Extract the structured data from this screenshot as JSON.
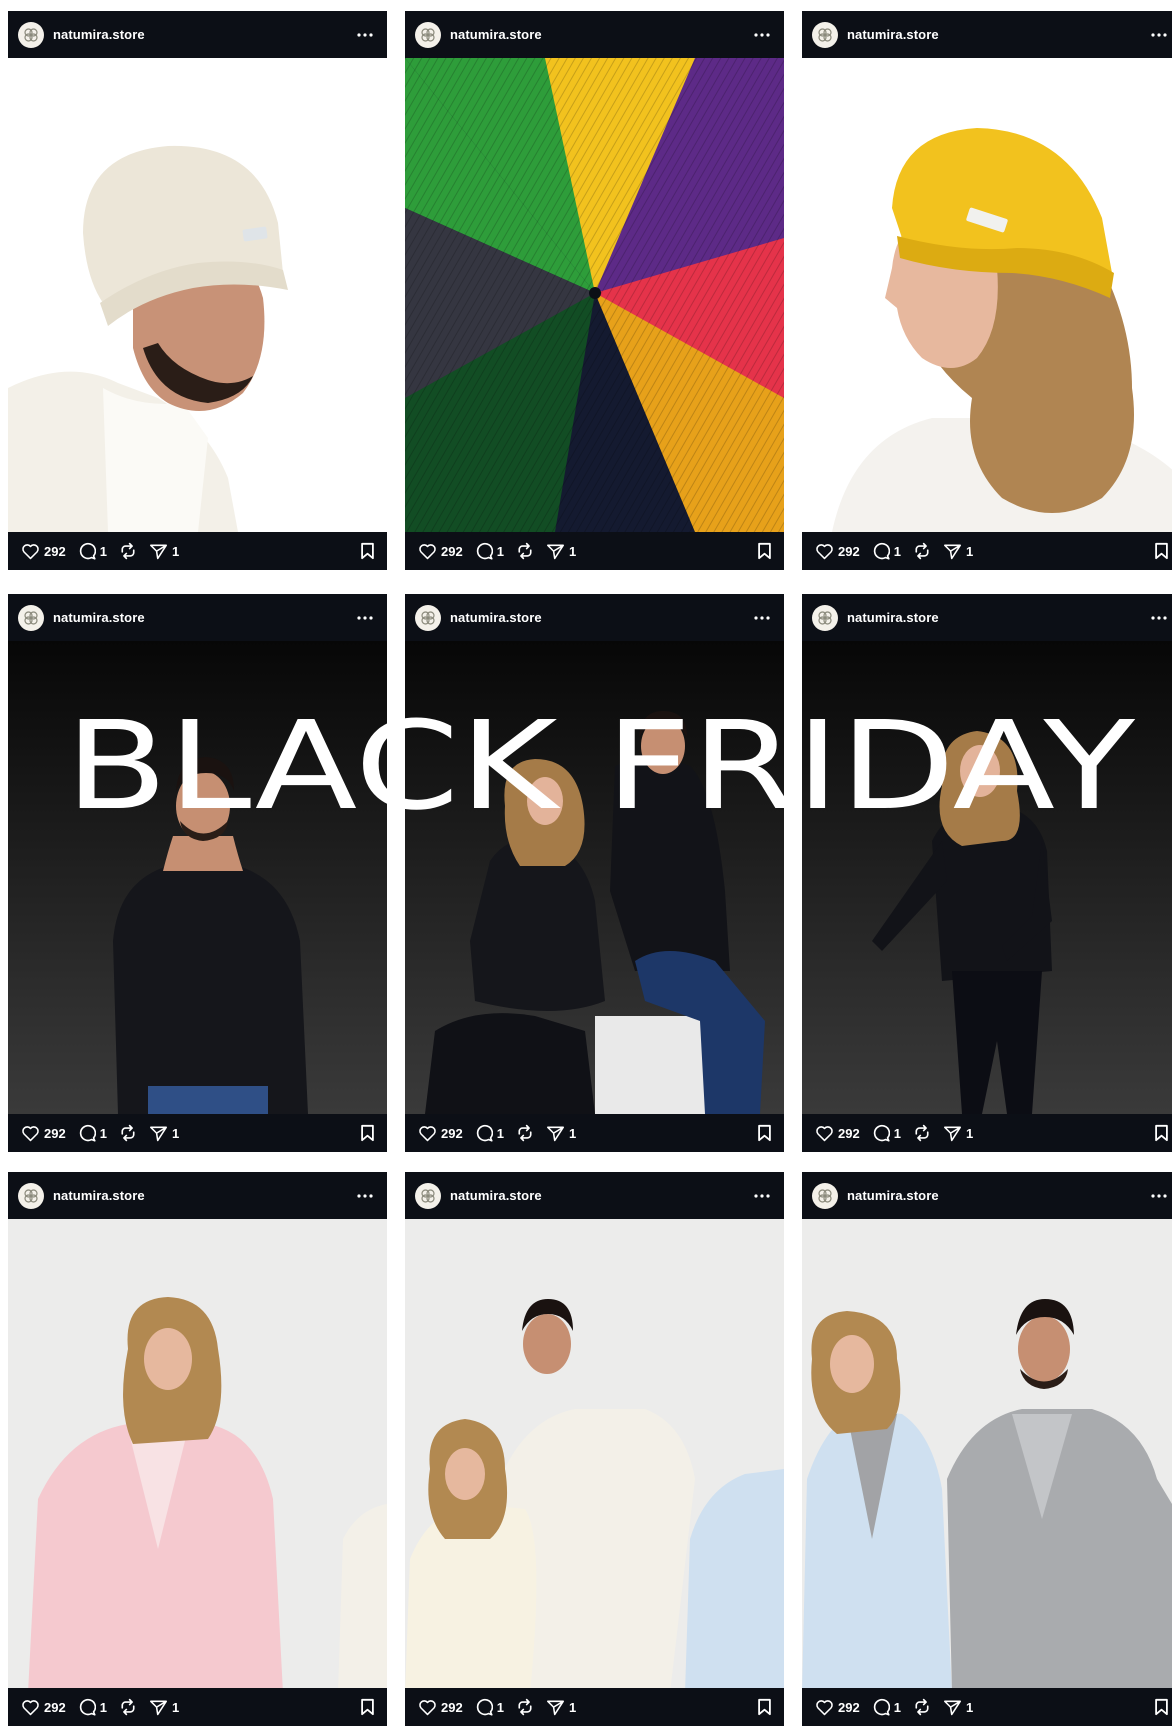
{
  "profile": {
    "username": "natumira.store",
    "avatar_icon": "natumira-logo-icon"
  },
  "banner": {
    "text": "BLACK FRIDAY"
  },
  "posts": [
    {
      "username": "natumira.store",
      "likes": "292",
      "comments": "1",
      "shares": "1"
    },
    {
      "username": "natumira.store",
      "likes": "292",
      "comments": "1",
      "shares": "1"
    },
    {
      "username": "natumira.store",
      "likes": "292",
      "comments": "1",
      "shares": "1"
    },
    {
      "username": "natumira.store",
      "likes": "292",
      "comments": "1",
      "shares": "1"
    },
    {
      "username": "natumira.store",
      "likes": "292",
      "comments": "1",
      "shares": "1"
    },
    {
      "username": "natumira.store",
      "likes": "292",
      "comments": "1",
      "shares": "1"
    },
    {
      "username": "natumira.store",
      "likes": "292",
      "comments": "1",
      "shares": "1"
    },
    {
      "username": "natumira.store",
      "likes": "292",
      "comments": "1",
      "shares": "1"
    },
    {
      "username": "natumira.store",
      "likes": "292",
      "comments": "1",
      "shares": "1"
    }
  ],
  "colors": {
    "card_bg": "#0c0f16",
    "hat_cream": "#ece6d8",
    "hat_yellow": "#f2c21e",
    "knit_green": "#2e9d3a",
    "knit_purple": "#5d2a87",
    "knit_red": "#e5334a",
    "knit_orange": "#e7a11a",
    "knit_darkgreen": "#124d24",
    "knit_navy": "#141a30",
    "knit_charcoal": "#353641",
    "cardigan_pink": "#f5c9cf",
    "cardigan_blue": "#cfe0f0",
    "cardigan_grey": "#a9abae",
    "sweater_white": "#f3f0e8"
  }
}
